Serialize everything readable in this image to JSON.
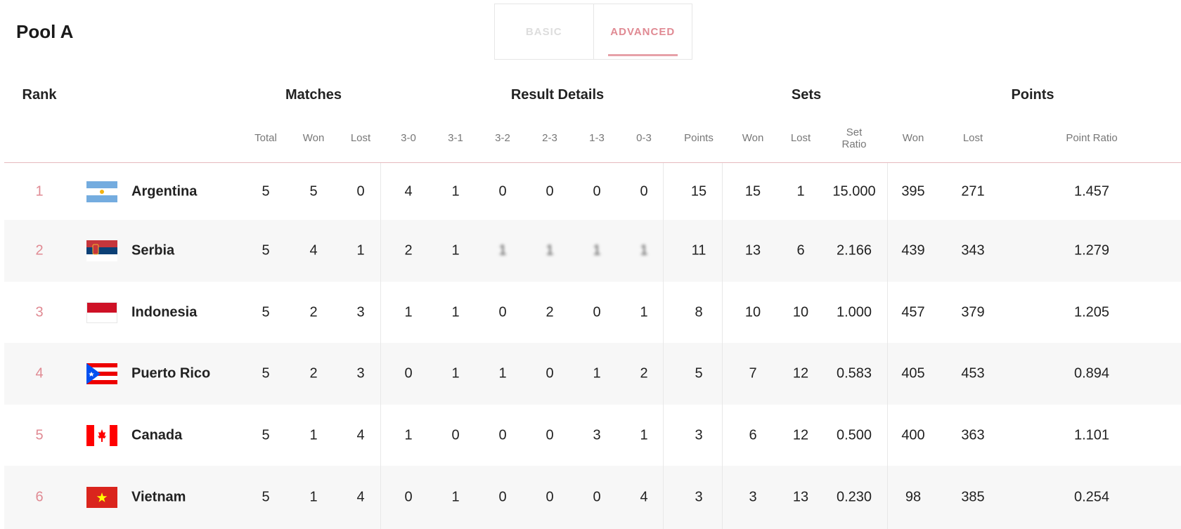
{
  "pool_title": "Pool A",
  "tabs": {
    "basic": "BASIC",
    "advanced": "ADVANCED",
    "active": "ADVANCED"
  },
  "group_headers": {
    "rank": "Rank",
    "matches": "Matches",
    "result_details": "Result Details",
    "sets": "Sets",
    "points": "Points"
  },
  "sub_headers": {
    "total": "Total",
    "won": "Won",
    "lost": "Lost",
    "r30": "3-0",
    "r31": "3-1",
    "r32": "3-2",
    "r23": "2-3",
    "r13": "1-3",
    "r03": "0-3",
    "points": "Points",
    "sets_won": "Won",
    "sets_lost": "Lost",
    "set_ratio_1": "Set",
    "set_ratio_2": "Ratio",
    "pts_won": "Won",
    "pts_lost": "Lost",
    "point_ratio": "Point Ratio"
  },
  "accent_color": "#e08a93",
  "rows": [
    {
      "rank": "1",
      "team": "Argentina",
      "flag": "argentina-flag",
      "total": "5",
      "won": "5",
      "lost": "0",
      "r30": "4",
      "r31": "1",
      "r32": "0",
      "r23": "0",
      "r13": "0",
      "r03": "0",
      "points": "15",
      "sets_won": "15",
      "sets_lost": "1",
      "set_ratio": "15.000",
      "pts_won": "395",
      "pts_lost": "271",
      "point_ratio": "1.457"
    },
    {
      "rank": "2",
      "team": "Serbia",
      "flag": "serbia-flag",
      "total": "5",
      "won": "4",
      "lost": "1",
      "r30": "2",
      "r31": "1",
      "r32": "1",
      "r23": "1",
      "r13": "1",
      "r03": "1",
      "points": "11",
      "sets_won": "13",
      "sets_lost": "6",
      "set_ratio": "2.166",
      "pts_won": "439",
      "pts_lost": "343",
      "point_ratio": "1.279"
    },
    {
      "rank": "3",
      "team": "Indonesia",
      "flag": "indonesia-flag",
      "total": "5",
      "won": "2",
      "lost": "3",
      "r30": "1",
      "r31": "1",
      "r32": "0",
      "r23": "2",
      "r13": "0",
      "r03": "1",
      "points": "8",
      "sets_won": "10",
      "sets_lost": "10",
      "set_ratio": "1.000",
      "pts_won": "457",
      "pts_lost": "379",
      "point_ratio": "1.205"
    },
    {
      "rank": "4",
      "team": "Puerto Rico",
      "flag": "puerto-rico-flag",
      "total": "5",
      "won": "2",
      "lost": "3",
      "r30": "0",
      "r31": "1",
      "r32": "1",
      "r23": "0",
      "r13": "1",
      "r03": "2",
      "points": "5",
      "sets_won": "7",
      "sets_lost": "12",
      "set_ratio": "0.583",
      "pts_won": "405",
      "pts_lost": "453",
      "point_ratio": "0.894"
    },
    {
      "rank": "5",
      "team": "Canada",
      "flag": "canada-flag",
      "total": "5",
      "won": "1",
      "lost": "4",
      "r30": "1",
      "r31": "0",
      "r32": "0",
      "r23": "0",
      "r13": "3",
      "r03": "1",
      "points": "3",
      "sets_won": "6",
      "sets_lost": "12",
      "set_ratio": "0.500",
      "pts_won": "400",
      "pts_lost": "363",
      "point_ratio": "1.101"
    },
    {
      "rank": "6",
      "team": "Vietnam",
      "flag": "vietnam-flag",
      "total": "5",
      "won": "1",
      "lost": "4",
      "r30": "0",
      "r31": "1",
      "r32": "0",
      "r23": "0",
      "r13": "0",
      "r03": "4",
      "points": "3",
      "sets_won": "3",
      "sets_lost": "13",
      "set_ratio": "0.230",
      "pts_won": "98",
      "pts_lost": "385",
      "point_ratio": "0.254"
    }
  ]
}
